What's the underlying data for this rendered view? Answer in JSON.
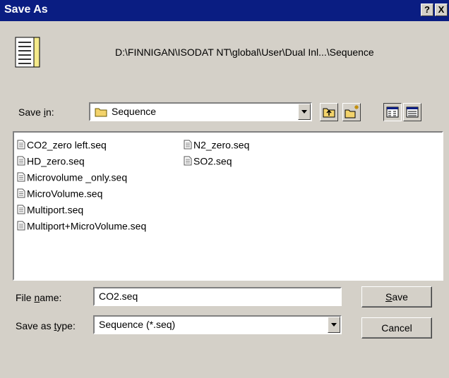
{
  "window": {
    "title": "Save As",
    "help_label": "?",
    "close_label": "X"
  },
  "path": "D:\\FINNIGAN\\ISODAT NT\\global\\User\\Dual Inl...\\Sequence",
  "save_in": {
    "label_pre": "Save ",
    "label_ul": "i",
    "label_post": "n:",
    "value": "Sequence"
  },
  "files": [
    {
      "name": "CO2_zero left.seq"
    },
    {
      "name": "HD_zero.seq"
    },
    {
      "name": "Microvolume _only.seq"
    },
    {
      "name": "MicroVolume.seq"
    },
    {
      "name": "Multiport.seq"
    },
    {
      "name": "Multiport+MicroVolume.seq"
    },
    {
      "name": "N2_zero.seq"
    },
    {
      "name": "SO2.seq"
    }
  ],
  "file_name": {
    "label_pre": "File ",
    "label_ul": "n",
    "label_post": "ame:",
    "value": "CO2.seq"
  },
  "save_type": {
    "label_pre": "Save as ",
    "label_ul": "t",
    "label_post": "ype:",
    "value": "Sequence (*.seq)"
  },
  "buttons": {
    "save_ul": "S",
    "save_post": "ave",
    "cancel": "Cancel"
  },
  "icons": {
    "up": "up-folder-icon",
    "new_folder": "new-folder-icon",
    "list_view": "list-view-icon",
    "details_view": "details-view-icon"
  }
}
